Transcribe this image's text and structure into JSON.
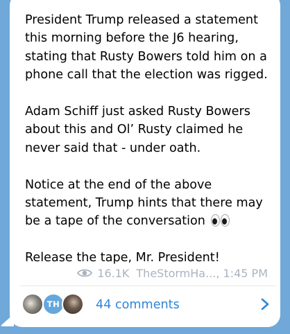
{
  "message": {
    "paragraphs": [
      {
        "lines": [
          "President Trump released a statement",
          "this morning before the J6 hearing,",
          "stating that Rusty Bowers told him on a",
          "phone call that the election was rigged."
        ]
      },
      {
        "lines": [
          "Adam Schiff just asked Rusty Bowers",
          "about this and Ol’ Rusty claimed he",
          "never said that - under oath."
        ]
      },
      {
        "lines": [
          "Notice at the end of the above",
          "statement, Trump hints that there may",
          "be a tape of the conversation"
        ],
        "trailing_emoji": "eyes-emoji"
      },
      {
        "lines": [
          "Release the tape, Mr. President!"
        ]
      }
    ]
  },
  "meta": {
    "view_icon": "eye-icon",
    "views": "16.1K",
    "author_time": "TheStormHa..., 1:45 PM"
  },
  "comments": {
    "avatars": [
      {
        "icon": "avatar-photo"
      },
      {
        "initials": "TH",
        "color": "#64a7dd"
      },
      {
        "icon": "avatar-photo"
      }
    ],
    "label": "44 comments",
    "chevron_icon": "chevron-right-icon"
  },
  "colors": {
    "background": "#6fa8d9",
    "bubble": "#ffffff",
    "text": "#000000",
    "meta": "#a9b4c0",
    "link": "#2e86d8"
  }
}
